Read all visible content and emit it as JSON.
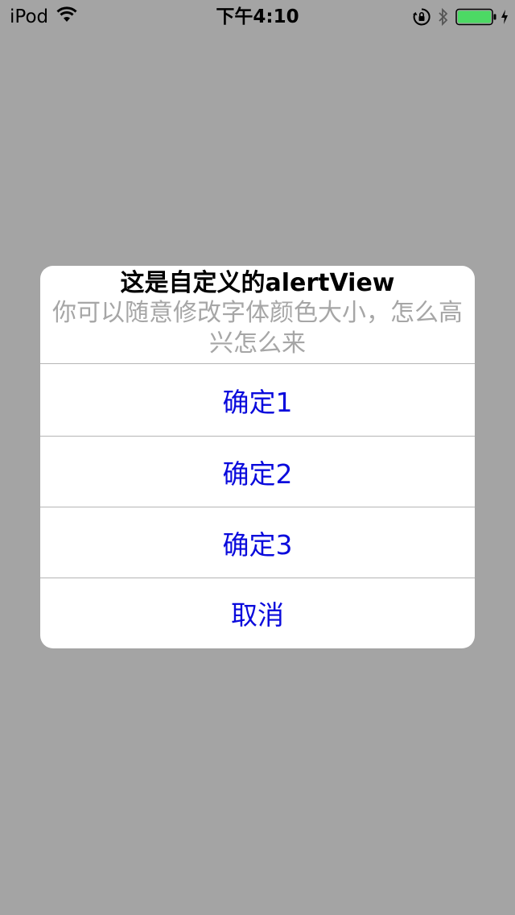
{
  "status_bar": {
    "device": "iPod",
    "time": "下午4:10",
    "wifi_icon": "wifi-icon",
    "rotation_lock_icon": "rotation-lock-icon",
    "bluetooth_icon": "bluetooth-icon",
    "battery_icon": "battery-icon",
    "charging_icon": "charging-bolt-icon",
    "battery_color": "#4cd964"
  },
  "alert": {
    "title": "这是自定义的alertView",
    "message": "你可以随意修改字体颜色大小，怎么高兴怎么来",
    "buttons": [
      {
        "label": "确定1"
      },
      {
        "label": "确定2"
      },
      {
        "label": "确定3"
      },
      {
        "label": "取消"
      }
    ],
    "button_color": "#0a0adc",
    "message_color": "#a6a6a6"
  }
}
